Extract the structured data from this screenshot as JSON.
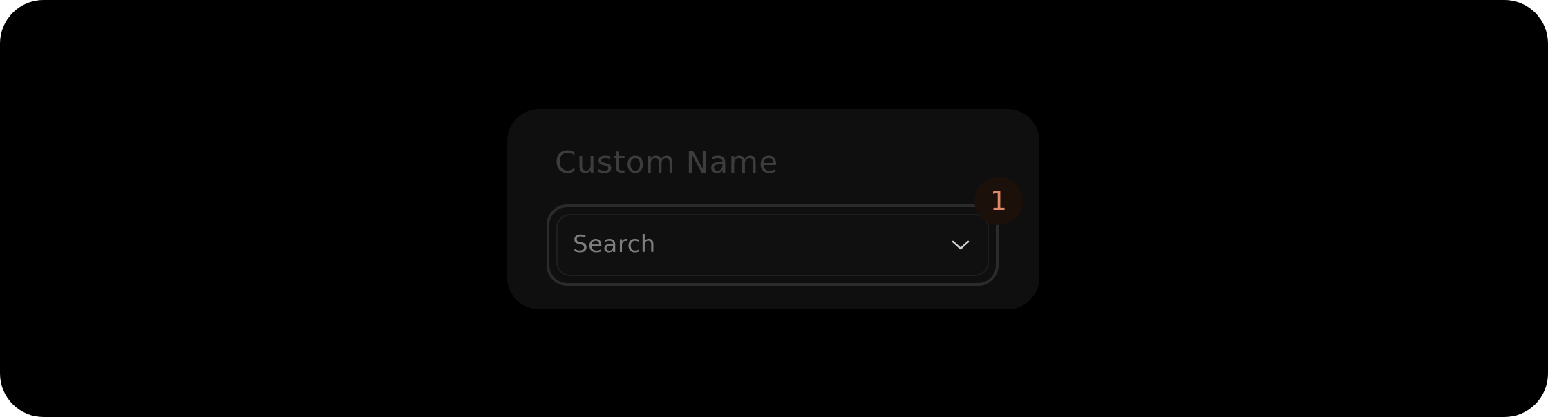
{
  "field": {
    "label": "Custom Name",
    "select_value": "Search"
  },
  "badge": {
    "count": "1"
  },
  "colors": {
    "background": "#000000",
    "panel": "#0f0f0f",
    "label": "#3d3d3d",
    "value_text": "#7e7e7e",
    "badge_bg": "#1c100b",
    "badge_text": "#e0876a"
  },
  "icons": {
    "dropdown": "chevron-down-icon"
  }
}
